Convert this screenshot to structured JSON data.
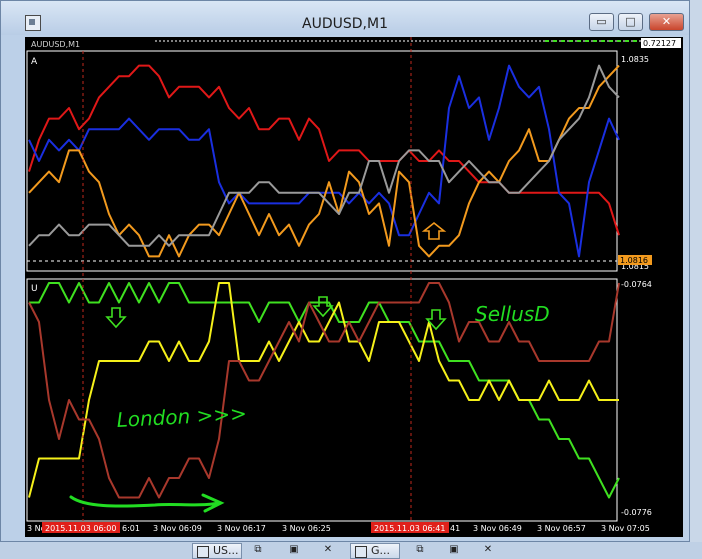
{
  "window": {
    "title": "AUDUSD,M1",
    "min_symbol": "▭",
    "max_symbol": "□",
    "close_symbol": "✕"
  },
  "top_strip": {
    "symbol_label": "AUDUSD,M1",
    "price_box": "0.72127"
  },
  "panel_top": {
    "label": "A",
    "y_high": "1.0835",
    "y_low": "1.0815",
    "current_price": "1.0816"
  },
  "panel_bottom": {
    "label": "U",
    "y_high": "-0.0764",
    "y_low": "-0.0776"
  },
  "time_axis": {
    "labels": [
      "3 No",
      "6:01",
      "3 Nov 06:09",
      "3 Nov 06:17",
      "3 Nov 06:25",
      "41",
      "3 Nov 06:49",
      "3 Nov 06:57",
      "3 Nov 07:05"
    ],
    "highlight_1": "2015.11.03 06:00",
    "highlight_2": "2015.11.03 06:41"
  },
  "annotations": {
    "london": "London >>>",
    "sell": "SellusD"
  },
  "colors": {
    "red": "#e01818",
    "blue": "#1a2fe0",
    "orange": "#f29a1e",
    "gray": "#9a9a9a",
    "green": "#3fe020",
    "yellow": "#f5f01a",
    "brown": "#a8382c",
    "annotation": "#22dd22"
  },
  "chart_data": {
    "type": "line",
    "panels": [
      {
        "name": "A",
        "ylim": [
          1.0815,
          1.0835
        ],
        "series": [
          {
            "color": "red",
            "values": [
              1.0824,
              1.0827,
              1.0829,
              1.0829,
              1.083,
              1.0828,
              1.0829,
              1.0831,
              1.0832,
              1.0833,
              1.0833,
              1.0834,
              1.0834,
              1.0833,
              1.0831,
              1.0832,
              1.0832,
              1.0832,
              1.0831,
              1.0832,
              1.083,
              1.0829,
              1.083,
              1.0828,
              1.0828,
              1.0829,
              1.0829,
              1.0827,
              1.0829,
              1.0828,
              1.0825,
              1.0826,
              1.0826,
              1.0826,
              1.0825,
              1.0825,
              1.0825,
              1.0825,
              1.0826,
              1.0825,
              1.0825,
              1.0826,
              1.0825,
              1.0825,
              1.0824,
              1.0823,
              1.0823,
              1.0823,
              1.0822,
              1.0822,
              1.0822,
              1.0822,
              1.0822,
              1.0822,
              1.0822,
              1.0822,
              1.0822,
              1.0822,
              1.0821,
              1.0818
            ]
          },
          {
            "color": "blue",
            "values": [
              1.0827,
              1.0825,
              1.0827,
              1.0826,
              1.0827,
              1.0826,
              1.0828,
              1.0828,
              1.0828,
              1.0828,
              1.0829,
              1.0828,
              1.0827,
              1.0828,
              1.0828,
              1.0828,
              1.0827,
              1.0827,
              1.0828,
              1.0823,
              1.0821,
              1.0822,
              1.0821,
              1.0821,
              1.0821,
              1.0821,
              1.0821,
              1.0821,
              1.0822,
              1.0822,
              1.0822,
              1.0822,
              1.0821,
              1.0822,
              1.0821,
              1.0822,
              1.0821,
              1.0818,
              1.0818,
              1.082,
              1.0822,
              1.0821,
              1.083,
              1.0833,
              1.083,
              1.0831,
              1.0827,
              1.083,
              1.0834,
              1.0832,
              1.0831,
              1.0832,
              1.0828,
              1.0822,
              1.0821,
              1.0816,
              1.0823,
              1.0826,
              1.0829,
              1.0827
            ]
          },
          {
            "color": "orange",
            "values": [
              1.0822,
              1.0823,
              1.0824,
              1.0823,
              1.0826,
              1.0826,
              1.0824,
              1.0823,
              1.082,
              1.0818,
              1.0819,
              1.0818,
              1.0816,
              1.0816,
              1.0818,
              1.0816,
              1.0818,
              1.0819,
              1.0819,
              1.0818,
              1.082,
              1.0822,
              1.082,
              1.0818,
              1.082,
              1.0818,
              1.0819,
              1.0817,
              1.0819,
              1.082,
              1.0823,
              1.082,
              1.0824,
              1.0823,
              1.082,
              1.0821,
              1.0817,
              1.0824,
              1.0823,
              1.0817,
              1.0816,
              1.0817,
              1.0817,
              1.0818,
              1.0821,
              1.0823,
              1.0824,
              1.0823,
              1.0825,
              1.0826,
              1.0828,
              1.0825,
              1.0825,
              1.0827,
              1.0829,
              1.083,
              1.083,
              1.0832,
              1.0833,
              1.0834
            ]
          },
          {
            "color": "gray",
            "values": [
              1.0817,
              1.0818,
              1.0818,
              1.0819,
              1.0818,
              1.0818,
              1.0819,
              1.0819,
              1.0819,
              1.0818,
              1.0817,
              1.0817,
              1.0817,
              1.0818,
              1.0817,
              1.0818,
              1.0818,
              1.0818,
              1.0818,
              1.082,
              1.0822,
              1.0822,
              1.0822,
              1.0823,
              1.0823,
              1.0822,
              1.0822,
              1.0822,
              1.0822,
              1.0822,
              1.0821,
              1.082,
              1.0822,
              1.0822,
              1.0825,
              1.0825,
              1.0822,
              1.0825,
              1.0826,
              1.0826,
              1.0825,
              1.0825,
              1.0823,
              1.0824,
              1.0825,
              1.0824,
              1.0823,
              1.0823,
              1.0822,
              1.0822,
              1.0823,
              1.0824,
              1.0825,
              1.0827,
              1.0828,
              1.0829,
              1.0831,
              1.0834,
              1.0832,
              1.0831
            ]
          }
        ]
      },
      {
        "name": "U",
        "ylim": [
          -0.0776,
          -0.0764
        ],
        "series": [
          {
            "color": "green",
            "values": [
              -0.0765,
              -0.0765,
              -0.0764,
              -0.0764,
              -0.0765,
              -0.0764,
              -0.0765,
              -0.0765,
              -0.0764,
              -0.0765,
              -0.0764,
              -0.0765,
              -0.0764,
              -0.0765,
              -0.0764,
              -0.0764,
              -0.0765,
              -0.0765,
              -0.0765,
              -0.0765,
              -0.0765,
              -0.0765,
              -0.0765,
              -0.0766,
              -0.0765,
              -0.0765,
              -0.0765,
              -0.0766,
              -0.0765,
              -0.0765,
              -0.0765,
              -0.0766,
              -0.0766,
              -0.0766,
              -0.0765,
              -0.0765,
              -0.0766,
              -0.0766,
              -0.0766,
              -0.0767,
              -0.0767,
              -0.0767,
              -0.0768,
              -0.0768,
              -0.0768,
              -0.0769,
              -0.0769,
              -0.0769,
              -0.0769,
              -0.077,
              -0.077,
              -0.0771,
              -0.0771,
              -0.0772,
              -0.0772,
              -0.0773,
              -0.0773,
              -0.0774,
              -0.0775,
              -0.0774
            ]
          },
          {
            "color": "yellow",
            "values": [
              -0.0775,
              -0.0773,
              -0.0773,
              -0.0773,
              -0.0773,
              -0.0773,
              -0.077,
              -0.0768,
              -0.0768,
              -0.0768,
              -0.0768,
              -0.0768,
              -0.0767,
              -0.0767,
              -0.0768,
              -0.0767,
              -0.0768,
              -0.0768,
              -0.0767,
              -0.0764,
              -0.0764,
              -0.0768,
              -0.0768,
              -0.0768,
              -0.0767,
              -0.0768,
              -0.0767,
              -0.0766,
              -0.0767,
              -0.0767,
              -0.0766,
              -0.0765,
              -0.0767,
              -0.0767,
              -0.0768,
              -0.0766,
              -0.0766,
              -0.0766,
              -0.0767,
              -0.0768,
              -0.0766,
              -0.0768,
              -0.0769,
              -0.0769,
              -0.077,
              -0.077,
              -0.0769,
              -0.077,
              -0.0769,
              -0.077,
              -0.077,
              -0.077,
              -0.0769,
              -0.077,
              -0.077,
              -0.077,
              -0.0769,
              -0.077,
              -0.077,
              -0.077
            ]
          },
          {
            "color": "brown",
            "values": [
              -0.0765,
              -0.0766,
              -0.077,
              -0.0772,
              -0.077,
              -0.0771,
              -0.0771,
              -0.0772,
              -0.0774,
              -0.0775,
              -0.0775,
              -0.0775,
              -0.0774,
              -0.0775,
              -0.0774,
              -0.0774,
              -0.0773,
              -0.0773,
              -0.0774,
              -0.0772,
              -0.0768,
              -0.0768,
              -0.0769,
              -0.0769,
              -0.0768,
              -0.0767,
              -0.0766,
              -0.0767,
              -0.0765,
              -0.0766,
              -0.0767,
              -0.0767,
              -0.0766,
              -0.0767,
              -0.0766,
              -0.0765,
              -0.0765,
              -0.0765,
              -0.0765,
              -0.0765,
              -0.0764,
              -0.0764,
              -0.0765,
              -0.0767,
              -0.0766,
              -0.0766,
              -0.0767,
              -0.0767,
              -0.0766,
              -0.0767,
              -0.0767,
              -0.0768,
              -0.0768,
              -0.0768,
              -0.0768,
              -0.0768,
              -0.0768,
              -0.0767,
              -0.0767,
              -0.0764
            ]
          }
        ]
      }
    ]
  }
}
